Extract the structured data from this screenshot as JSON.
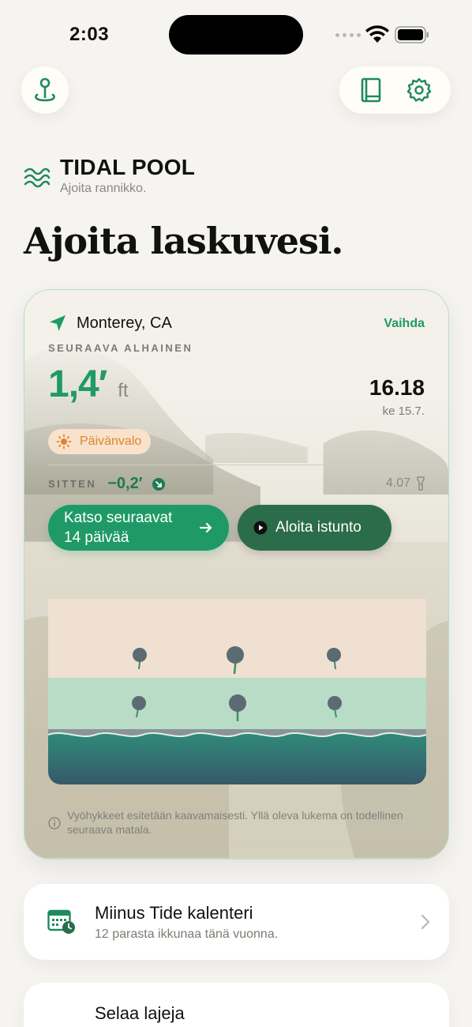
{
  "status": {
    "time": "2:03"
  },
  "brand": {
    "title": "TIDAL POOL",
    "tagline": "Ajoita rannikko."
  },
  "headline": "Ajoita laskuvesi.",
  "card": {
    "location": "Monterey, CA",
    "change_label": "Vaihda",
    "next_low_label": "SEURAAVA ALHAINEN",
    "height_value": "1,4′",
    "height_unit": "ft",
    "time": "16.18",
    "date": "ke 15.7.",
    "daylight_label": "Päivänvalo",
    "since_label": "SITTEN",
    "since_value": "−0,2′",
    "since_time": "4.07",
    "primary_button": "Katso seuraavat 14 päivää",
    "secondary_button": "Aloita istunto",
    "footnote": "Vyöhykkeet esitetään kaavamaisesti. Yllä oleva lukema on todellinen seuraava matala."
  },
  "calendar": {
    "title": "Miinus Tide kalenteri",
    "subtitle": "12 parasta ikkunaa tänä vuonna."
  },
  "browse": {
    "title": "Selaa lajeja"
  },
  "colors": {
    "accent": "#1f9a66",
    "accent_dark": "#2b6d4a",
    "daylight": "#e0852c"
  }
}
